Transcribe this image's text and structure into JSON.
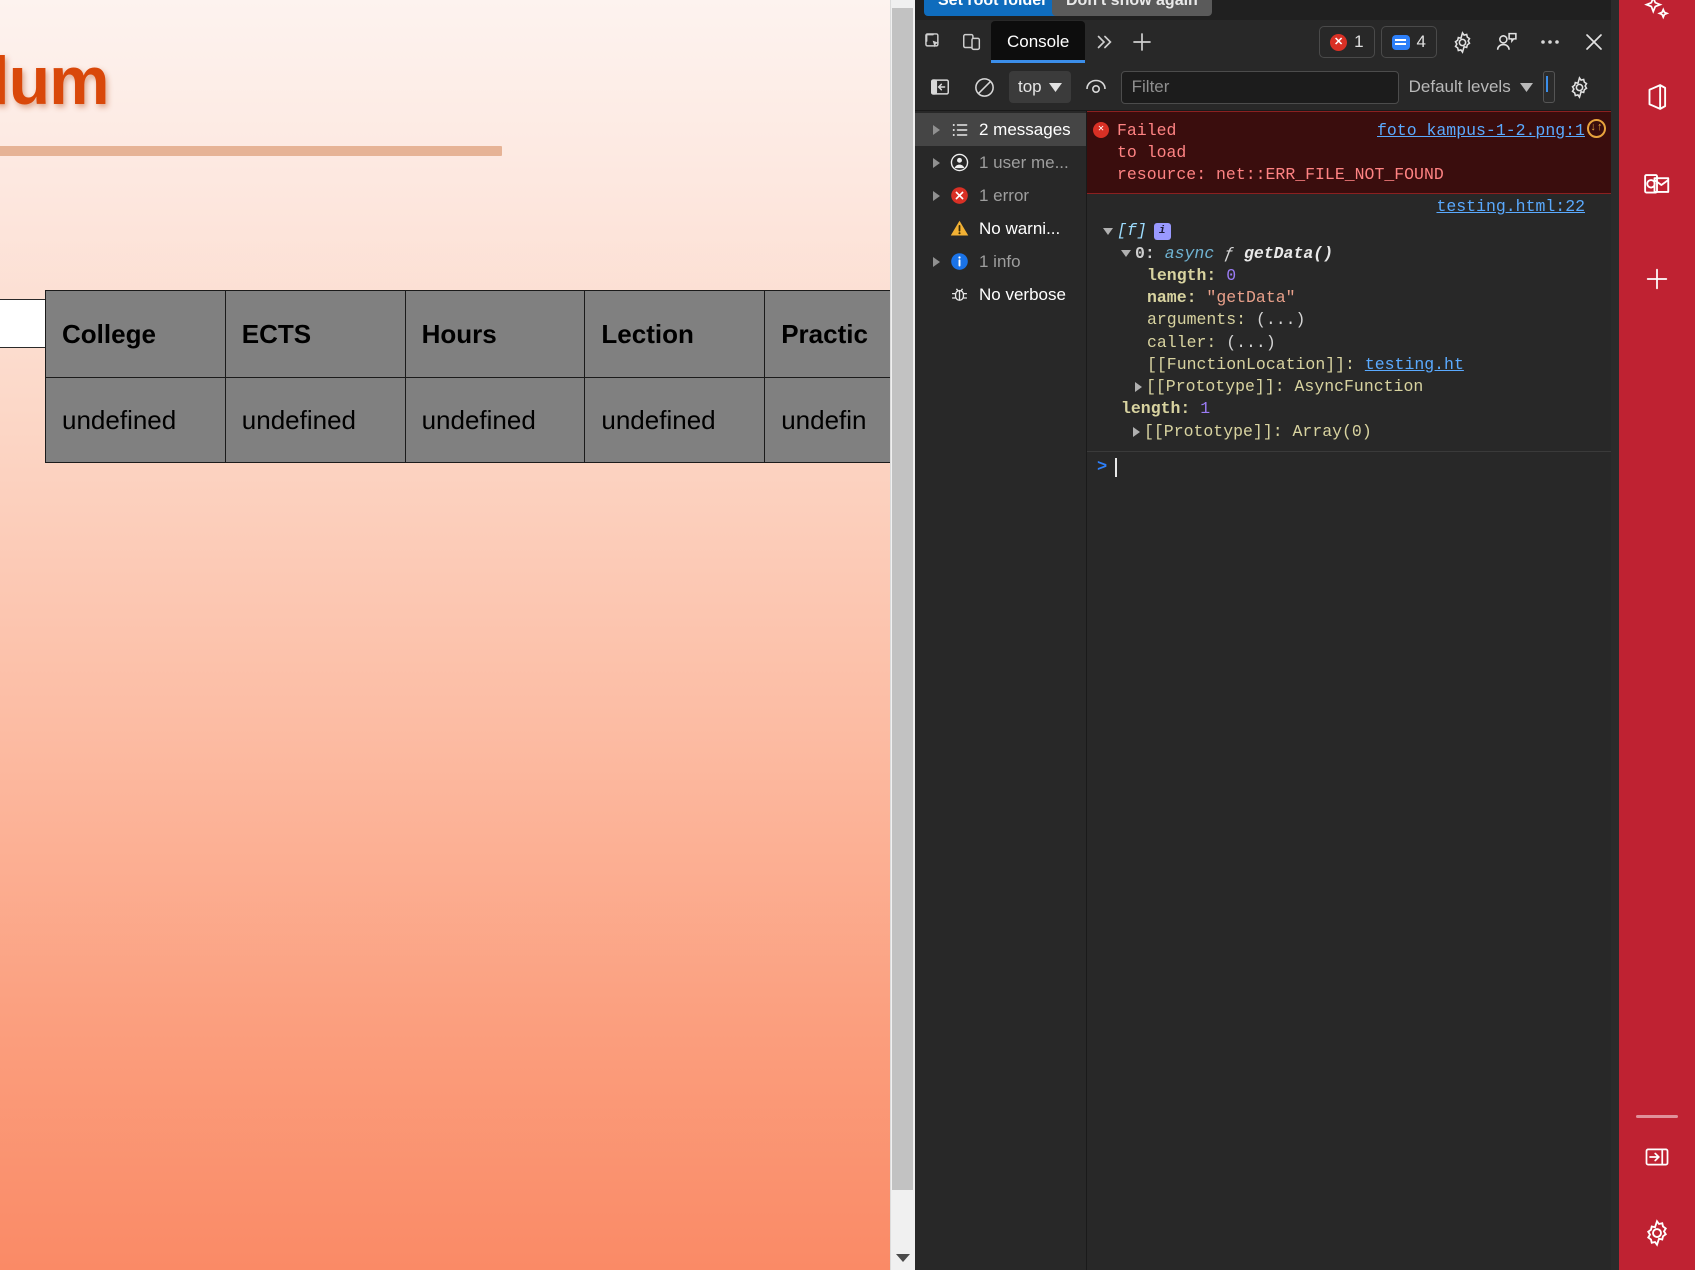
{
  "page": {
    "heading": "riculum",
    "table": {
      "headers": [
        "College",
        "ECTS",
        "Hours",
        "Lection",
        "Practic"
      ],
      "rows": [
        [
          "undefined",
          "undefined",
          "undefined",
          "undefined",
          "undefin"
        ]
      ]
    }
  },
  "devtools": {
    "notification": {
      "set_root_label": "Set root folder",
      "dont_show_label": "Don't show again"
    },
    "toolbar": {
      "inspect_icon": "inspect-element-icon",
      "device_icon": "device-toolbar-icon",
      "tab_label": "Console",
      "more_tabs_icon": "chevron-double-right-icon",
      "add_tab_icon": "plus-icon",
      "error_count": "1",
      "message_count": "4",
      "settings_icon": "gear-icon",
      "issues_icon": "issues-icon",
      "more_icon": "ellipsis-icon",
      "close_icon": "close-icon"
    },
    "filterbar": {
      "sidebar_toggle_icon": "show-console-sidebar-icon",
      "clear_icon": "clear-console-icon",
      "context": "top",
      "eye_icon": "live-expression-icon",
      "filter_placeholder": "Filter",
      "filter_value": "",
      "levels": "Default levels",
      "settings_icon": "console-settings-gear-icon"
    },
    "sidebar": [
      {
        "label": "2 messages",
        "icon": "list-icon",
        "selected": true,
        "expandable": true
      },
      {
        "label": "1 user me...",
        "icon": "user-icon",
        "selected": false,
        "expandable": true
      },
      {
        "label": "1 error",
        "icon": "error-icon",
        "selected": false,
        "expandable": true
      },
      {
        "label": "No warni...",
        "icon": "warning-icon",
        "selected": false,
        "expandable": false
      },
      {
        "label": "1 info",
        "icon": "info-icon",
        "selected": false,
        "expandable": true
      },
      {
        "label": "No verbose",
        "icon": "bug-icon",
        "selected": false,
        "expandable": false
      }
    ],
    "console": {
      "error_message": {
        "text_part1": "Failed",
        "text_part2": "to load",
        "text_part3": "resource: net::ERR_FILE_NOT_FOUND",
        "link": "foto_kampus-1-2.png:1",
        "warn_icon": "network-request-blocked-icon",
        "search_icon": "search-icon"
      },
      "object_log": {
        "source_link": "testing.html:22",
        "root_label": "[f]",
        "info_badge": "i",
        "entry_index": "0:",
        "entry_async": "async",
        "entry_f": "ƒ",
        "entry_fn": "getData()",
        "props": [
          {
            "key": "length:",
            "value": "0",
            "type": "number",
            "bold": true
          },
          {
            "key": "name:",
            "value": "\"getData\"",
            "type": "string",
            "bold": true
          },
          {
            "key": "arguments:",
            "value": "(...)",
            "type": "dots",
            "bold": false
          },
          {
            "key": "caller:",
            "value": "(...)",
            "type": "dots",
            "bold": false
          },
          {
            "key": "[[FunctionLocation]]:",
            "value": "testing.ht",
            "type": "link",
            "bold": false
          }
        ],
        "proto_inner": "[[Prototype]]: AsyncFunction",
        "outer_length_key": "length:",
        "outer_length_val": "1",
        "proto_outer": "[[Prototype]]: Array(0)"
      },
      "prompt_symbol": ">"
    }
  },
  "edge_sidebar": {
    "items": [
      {
        "icon": "copilot-sparkle-icon",
        "name": "copilot"
      },
      {
        "icon": "office-icon",
        "name": "office"
      },
      {
        "icon": "outlook-icon",
        "name": "outlook"
      },
      {
        "icon": "plus-icon",
        "name": "customize"
      }
    ],
    "bottom_items": [
      {
        "icon": "collapse-panel-icon",
        "name": "collapse"
      },
      {
        "icon": "gear-icon",
        "name": "settings"
      }
    ]
  }
}
